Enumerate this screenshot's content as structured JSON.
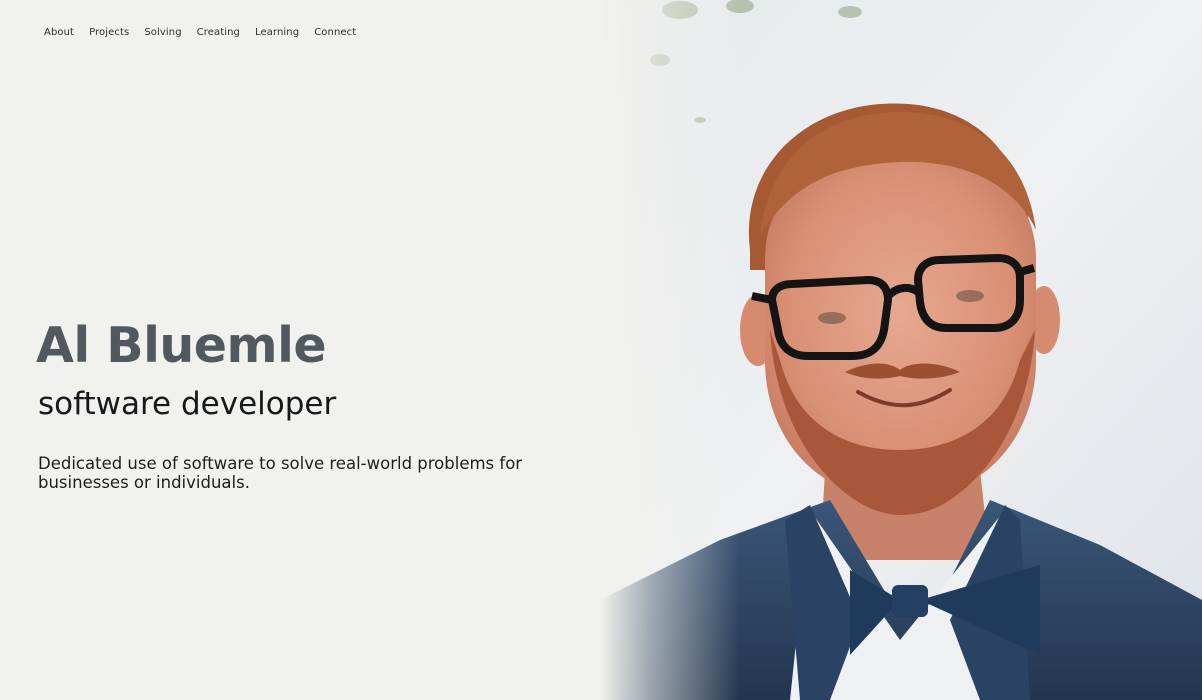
{
  "nav": {
    "items": [
      {
        "label": "About"
      },
      {
        "label": "Projects"
      },
      {
        "label": "Solving"
      },
      {
        "label": "Creating"
      },
      {
        "label": "Learning"
      },
      {
        "label": "Connect"
      }
    ]
  },
  "hero": {
    "name": "Al Bluemle",
    "role": "software developer",
    "tagline": "Dedicated use of software to solve real-world problems for businesses or individuals."
  },
  "colors": {
    "background": "#f1f1ed",
    "name_text": "#51585e",
    "body_text": "#1b1f22",
    "suit": "#2c4563",
    "hair": "#a55a34"
  },
  "icons": {
    "portrait": "portrait-photo"
  }
}
